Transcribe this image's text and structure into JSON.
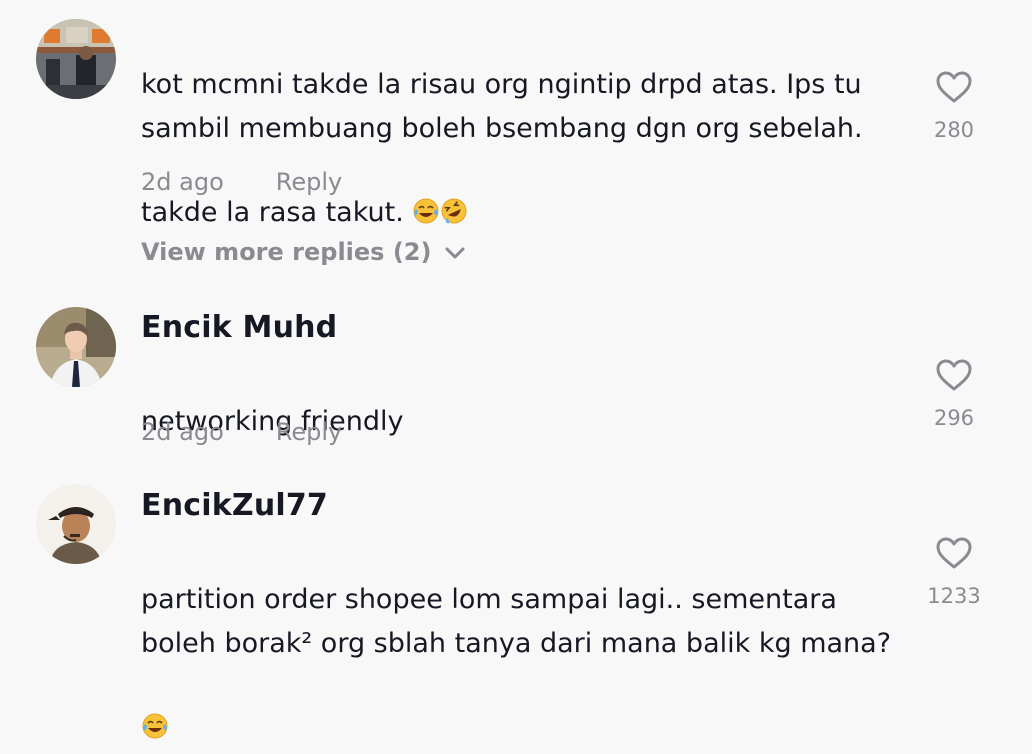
{
  "comments": [
    {
      "username": "",
      "text": "kot mcmni takde la risau org ngintip drpd atas. Ips tu sambil membuang boleh bsembang dgn org sebelah. takde la rasa takut. ",
      "emojis": [
        "face-with-tears-of-joy",
        "rolling-on-the-floor-laughing"
      ],
      "time": "2d ago",
      "reply_label": "Reply",
      "likes": "280",
      "view_more": "View more replies (2)"
    },
    {
      "username": "Encik Muhd",
      "text": "networking friendly",
      "time": "2d ago",
      "reply_label": "Reply",
      "likes": "296"
    },
    {
      "username": "EncikZul77",
      "text": "partition order shopee lom sampai lagi.. sementara boleh borak² org sblah tanya dari mana balik kg mana?",
      "emojis": [
        "face-with-tears-of-joy"
      ],
      "time": "",
      "reply_label": "",
      "likes": "1233"
    }
  ],
  "colors": {
    "background": "#f8f8f8",
    "text": "#161823",
    "muted": "#8a8b91"
  }
}
